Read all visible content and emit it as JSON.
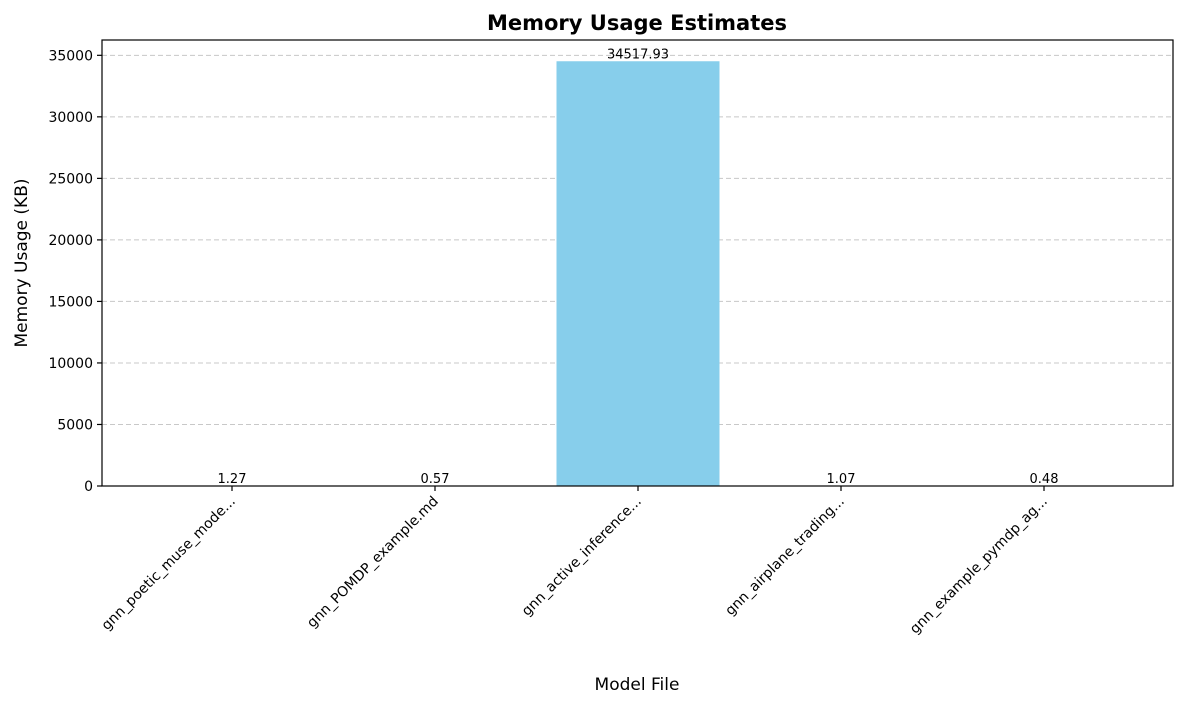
{
  "chart_data": {
    "type": "bar",
    "title": "Memory Usage Estimates",
    "xlabel": "Model File",
    "ylabel": "Memory Usage (KB)",
    "categories": [
      "gnn_poetic_muse_mode...",
      "gnn_POMDP_example.md",
      "gnn_active_inference...",
      "gnn_airplane_trading...",
      "gnn_example_pymdp_ag..."
    ],
    "values": [
      1.27,
      0.57,
      34517.93,
      1.07,
      0.48
    ],
    "value_labels": [
      "1.27",
      "0.57",
      "34517.93",
      "1.07",
      "0.48"
    ],
    "ylim": [
      0,
      36245
    ],
    "yticks": [
      0,
      5000,
      10000,
      15000,
      20000,
      25000,
      30000,
      35000
    ],
    "ytick_labels": [
      "0",
      "5000",
      "10000",
      "15000",
      "20000",
      "25000",
      "30000",
      "35000"
    ],
    "grid": "y-dashed",
    "bar_color": "#87ceeb"
  }
}
